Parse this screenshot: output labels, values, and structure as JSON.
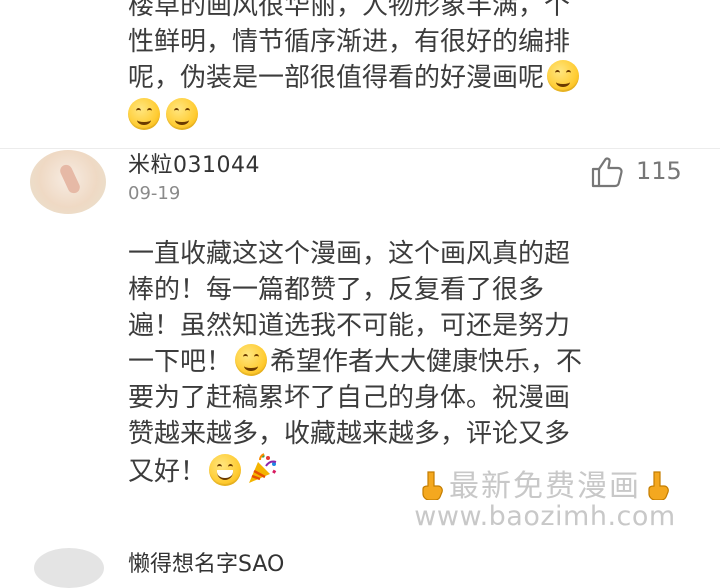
{
  "previous_comment": {
    "lines": [
      "楼草的画风很华丽，人物形象丰满，个",
      "性鲜明，情节循序渐进，有很好的编排",
      "呢，伪装是一部很值得看的好漫画呢"
    ],
    "line4_emoji_count": 2
  },
  "comment": {
    "username": "米粒031044",
    "date": "09-19",
    "likes": "115",
    "lines": [
      "一直收藏这这个漫画，这个画风真的超",
      "棒的！每一篇都赞了，反复看了很多",
      "遍！虽然知道选我不可能，可还是努力",
      "一下吧！",
      "希望作者大大健康快乐，不",
      "要为了赶稿累坏了自己的身体。祝漫画",
      "赞越来越多，收藏越来越多，评论又多",
      "又好！"
    ]
  },
  "watermark": {
    "line1": "最新免费漫画",
    "line2": "www.baozimh.com"
  },
  "next_comment": {
    "username": "懒得想名字SAO"
  },
  "icons": {
    "like": "thumbs-up-icon",
    "smile": "smiling-face-emoji",
    "grin": "grinning-face-emoji",
    "party": "party-popper-emoji",
    "pointing": "backhand-index-pointing-down-emoji"
  }
}
